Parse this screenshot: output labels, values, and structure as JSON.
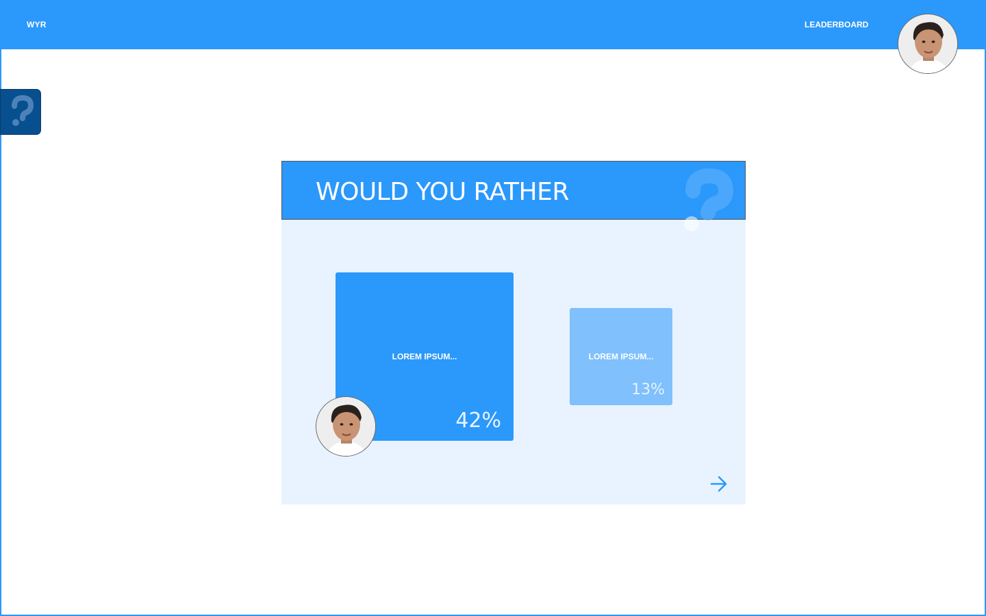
{
  "header": {
    "brand": "WYR",
    "nav_leaderboard": "LEADERBOARD",
    "avatar_icon": "user-avatar-photo"
  },
  "help_tab": {
    "icon": "question-mark-icon"
  },
  "card": {
    "title": "WOULD YOU RATHER",
    "options": [
      {
        "label": "LOREM IPSUM...",
        "percent": "42%",
        "selected": true
      },
      {
        "label": "LOREM IPSUM...",
        "percent": "13%",
        "selected": false
      }
    ],
    "next_icon": "arrow-right-icon"
  },
  "colors": {
    "primary": "#2b98fb",
    "primary_light": "#7fc0fd",
    "card_bg": "#e8f3ff",
    "help_tab": "#074f8f"
  }
}
